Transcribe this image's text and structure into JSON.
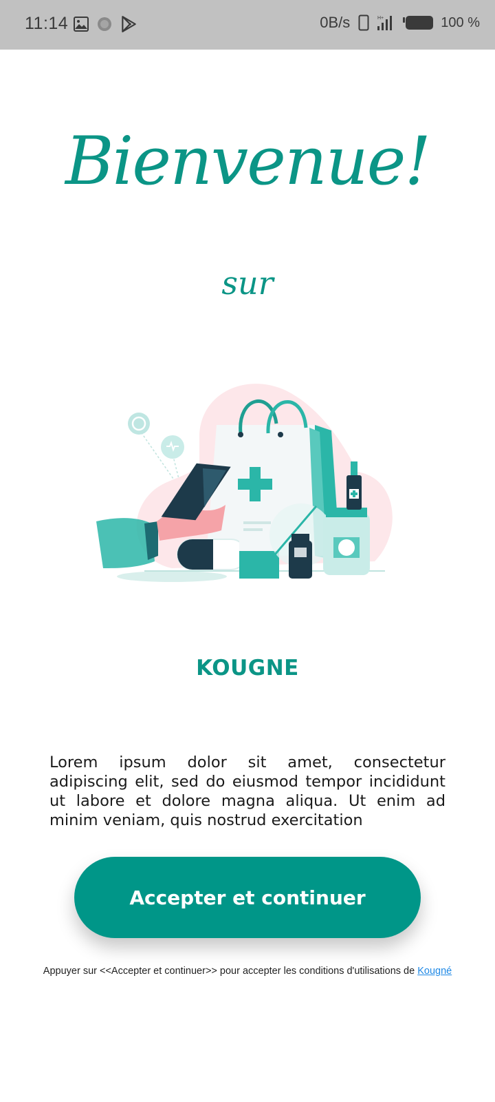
{
  "status_bar": {
    "time": "11:14",
    "left_icons": [
      "image-icon",
      "notification-dot-icon",
      "play-store-icon"
    ],
    "network_speed": "0B/s",
    "right_icons": [
      "phone-icon",
      "signal-icon",
      "battery-icon"
    ],
    "battery_level": "100 %"
  },
  "welcome": {
    "title": "Bienvenue!",
    "subtitle": "sur"
  },
  "illustration": {
    "icon": "pharmacy-illustration",
    "colors": {
      "teal": "#2bb6a8",
      "teal_dark": "#0b9586",
      "pink": "#fde7ea",
      "navy": "#1d3a4a"
    }
  },
  "brand": {
    "name": "KOUGNE"
  },
  "description": {
    "text": "Lorem ipsum dolor sit amet, consectetur adipiscing elit, sed do eiusmod tempor incididunt ut labore et dolore magna aliqua. Ut enim ad minim veniam, quis nostrud exercitation"
  },
  "actions": {
    "accept_label": "Accepter et continuer"
  },
  "terms": {
    "prefix": "Appuyer sur <<Accepter et continuer>> pour accepter les conditions d'utilisations de ",
    "link_label": "Kougné"
  },
  "theme": {
    "primary": "#009688",
    "link": "#1e88e5",
    "status_bar_bg": "#c1c1c1"
  }
}
